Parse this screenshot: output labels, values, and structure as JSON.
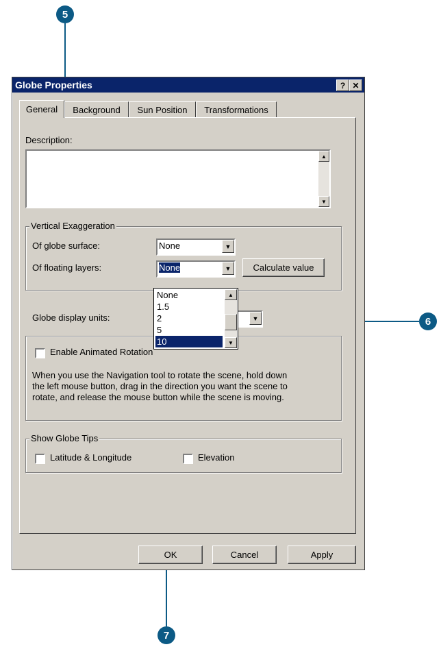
{
  "callouts": {
    "c5": "5",
    "c6": "6",
    "c7": "7"
  },
  "window": {
    "title": "Globe Properties",
    "help_button": "?",
    "close_button": "✕"
  },
  "tabs": [
    {
      "label": "General",
      "active": true
    },
    {
      "label": "Background"
    },
    {
      "label": "Sun Position"
    },
    {
      "label": "Transformations"
    }
  ],
  "general": {
    "description_label": "Description:",
    "description_value": "",
    "vertical_exaggeration": {
      "title": "Vertical Exaggeration",
      "surface_label": "Of globe surface:",
      "surface_value": "None",
      "floating_label": "Of floating layers:",
      "floating_value": "None",
      "calculate_button": "Calculate value"
    },
    "display_units_label": "Globe display units:",
    "dropdown_options": [
      "None",
      "1.5",
      "2",
      "5",
      "10"
    ],
    "dropdown_selected": "10",
    "animated_rotation": {
      "checkbox_label": "Enable Animated Rotation",
      "checked": false,
      "help_text_1": "When you use the Navigation tool to rotate the scene, hold down",
      "help_text_2": "the left mouse button, drag in the direction you want the scene to",
      "help_text_3": "rotate, and release the mouse button while the scene is moving."
    },
    "globe_tips": {
      "title": "Show Globe Tips",
      "latlong_label": "Latitude & Longitude",
      "elevation_label": "Elevation"
    }
  },
  "footer": {
    "ok": "OK",
    "cancel": "Cancel",
    "apply": "Apply"
  }
}
